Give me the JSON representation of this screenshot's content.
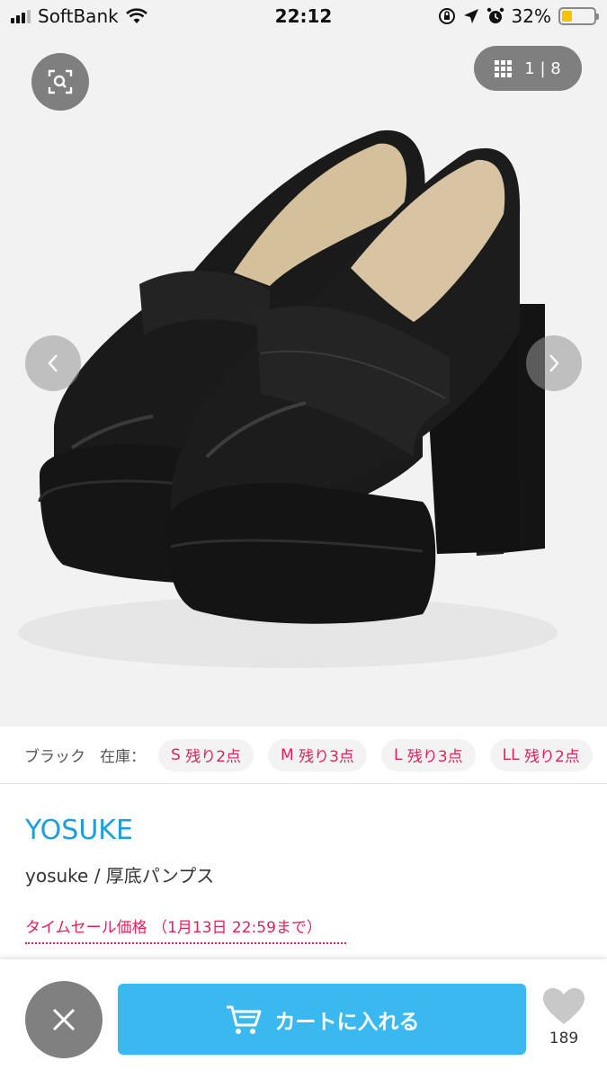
{
  "status_bar": {
    "carrier": "SoftBank",
    "time": "22:12",
    "battery_percent": "32%",
    "battery_level": 0.32
  },
  "gallery": {
    "counter_current": "1",
    "counter_separator": "|",
    "counter_total": "8",
    "icons": [
      "zoom-search-icon",
      "grid-icon",
      "chevron-left-icon",
      "chevron-right-icon"
    ]
  },
  "stock": {
    "color": "ブラック",
    "label": "在庫：",
    "chips": [
      {
        "size": "S",
        "text": "残り2点"
      },
      {
        "size": "M",
        "text": "残り3点"
      },
      {
        "size": "L",
        "text": "残り3点"
      },
      {
        "size": "LL",
        "text": "残り2点"
      }
    ]
  },
  "product": {
    "brand": "YOSUKE",
    "name": "yosuke / 厚底パンプス",
    "sale": "タイムセール価格 （1月13日 22:59まで）"
  },
  "actions": {
    "cart_label": "カートに入れる",
    "fav_count": "189"
  },
  "colors": {
    "brand_blue": "#1b9fdc",
    "cart_blue": "#3ab8f0",
    "sale_pink": "#e0225b"
  }
}
